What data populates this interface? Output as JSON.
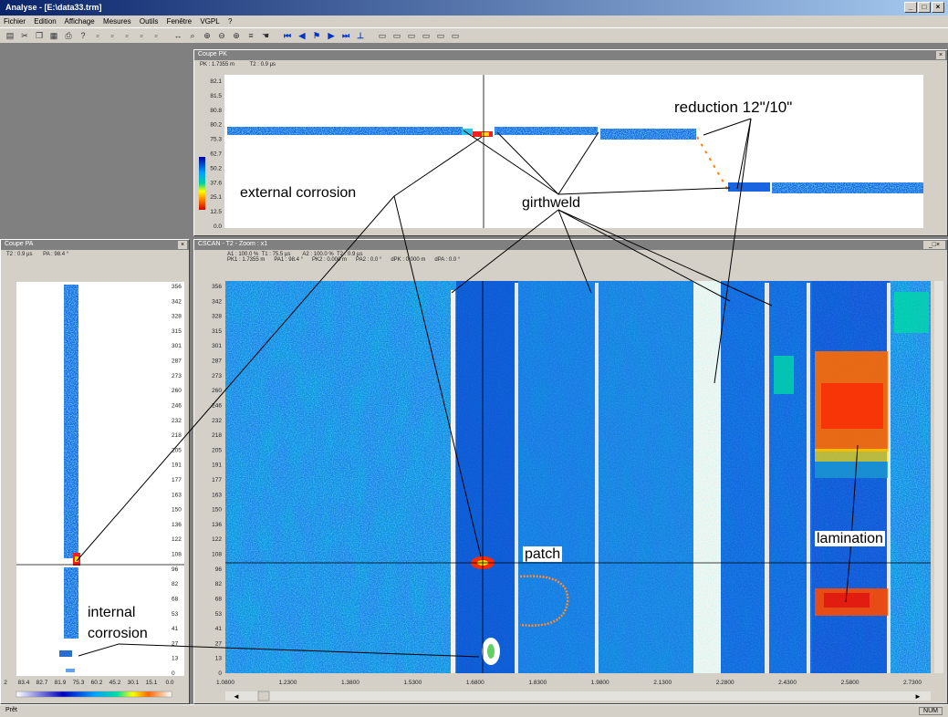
{
  "window": {
    "title": "Analyse - [E:\\data33.trm]",
    "min": "_",
    "max": "□",
    "close": "×"
  },
  "menu": [
    "Fichier",
    "Edition",
    "Affichage",
    "Mesures",
    "Outils",
    "Fenêtre",
    "VGPL",
    "?"
  ],
  "top_panel": {
    "title": "Coupe PK",
    "pk": "PK : 1.7355 m",
    "t2": "T2 : 0.9 µs",
    "y_ticks": [
      "82.1",
      "81.5",
      "80.8",
      "80.2",
      "75.3",
      "62.7",
      "50.2",
      "37.6",
      "25.1",
      "12.5",
      "0.0"
    ]
  },
  "left_panel": {
    "title": "Coupe PA",
    "t2": "T2 : 0.9 µs",
    "pa": "PA : 98.4 °",
    "y_ticks": [
      "356",
      "342",
      "328",
      "315",
      "301",
      "287",
      "273",
      "260",
      "246",
      "232",
      "218",
      "205",
      "191",
      "177",
      "163",
      "150",
      "136",
      "122",
      "108",
      "96",
      "82",
      "68",
      "53",
      "41",
      "27",
      "13",
      "0"
    ],
    "x_ticks": [
      "2",
      "83.4",
      "82.7",
      "81.9",
      "75.3",
      "60.2",
      "45.2",
      "30.1",
      "15.1",
      "0.0"
    ]
  },
  "cscan_panel": {
    "title": "CSCAN - T2 - Zoom : x1",
    "line1": "A1 : 100.0 %  T1 : 75.5 µs        A2 : 100.0 %  T2 : 0.9 µs",
    "line2": "PK1 : 1.7355 m      PA1 : 98.4 °      PK2 : 0.000 m      PA2 : 0.0 °      dPK : 0.000 m      dPA : 0.0 °",
    "y_ticks": [
      "356",
      "342",
      "328",
      "315",
      "301",
      "287",
      "273",
      "260",
      "246",
      "232",
      "218",
      "205",
      "191",
      "177",
      "163",
      "150",
      "136",
      "122",
      "108",
      "96",
      "82",
      "68",
      "53",
      "41",
      "27",
      "13",
      "0"
    ],
    "x_ticks": [
      "1.0800",
      "1.2300",
      "1.3800",
      "1.5300",
      "1.6800",
      "1.8300",
      "1.9800",
      "2.1300",
      "2.2800",
      "2.4300",
      "2.5800",
      "2.7300"
    ],
    "scroll_left": "◄",
    "scroll_right": "►"
  },
  "annotations": {
    "reduction": "reduction 12\"/10\"",
    "external_corrosion": "external corrosion",
    "girthweld": "girthweld",
    "patch": "patch",
    "lamination": "lamination",
    "internal_corrosion_1": "internal",
    "internal_corrosion_2": "corrosion"
  },
  "status": {
    "left": "Prêt",
    "right": "NUM"
  }
}
